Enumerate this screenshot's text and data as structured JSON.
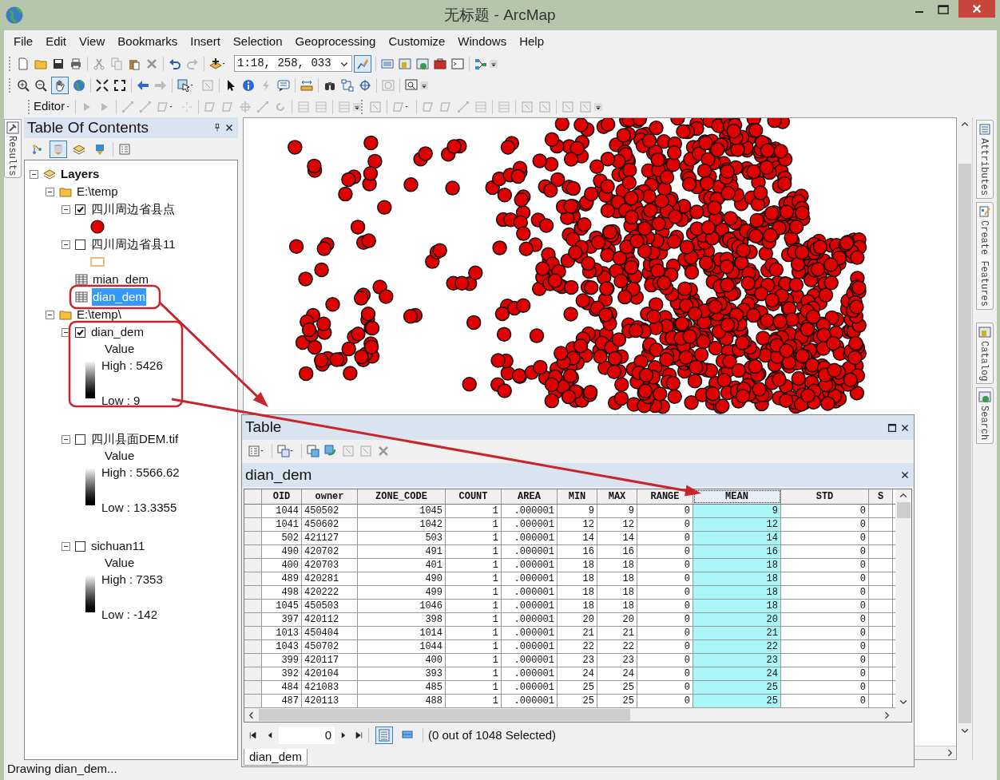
{
  "window": {
    "title": "无标题 - ArcMap"
  },
  "menu": [
    "File",
    "Edit",
    "View",
    "Bookmarks",
    "Insert",
    "Selection",
    "Geoprocessing",
    "Customize",
    "Windows",
    "Help"
  ],
  "standard_toolbar": {
    "scale": "1:18, 258, 033",
    "editor_toolbar_shown": true
  },
  "tools_toolbar": {
    "pan_tool": {
      "selected": true
    }
  },
  "editor_toolbar": {
    "label": "Editor"
  },
  "left_dock_tabs": [
    "Results"
  ],
  "toc": {
    "title": "Table Of Contents",
    "view_buttons": [
      {
        "kind": "drawing_order",
        "selected": false
      },
      {
        "kind": "source",
        "selected": true
      },
      {
        "kind": "visibility",
        "selected": false
      },
      {
        "kind": "selection",
        "selected": false
      }
    ],
    "tree": [
      {
        "label": "Layers",
        "kind": "frame",
        "expanded": true,
        "selected": false,
        "children": [
          {
            "label": "E:\\temp",
            "kind": "folder",
            "expanded": true,
            "selected": false,
            "children": [
              {
                "label": "四川周边省县点",
                "kind": "layer",
                "expanded": true,
                "checked": true,
                "selected": false,
                "legend": {
                  "kind": "point"
                }
              },
              {
                "label": "四川周边省县11",
                "kind": "layer",
                "expanded": true,
                "checked": false,
                "selected": false,
                "legend": {
                  "kind": "polygon"
                }
              },
              {
                "label": "mian_dem",
                "kind": "table",
                "selected": false
              },
              {
                "label": "dian_dem",
                "kind": "table",
                "selected": true
              }
            ]
          },
          {
            "label": "E:\\temp\\",
            "kind": "folder",
            "expanded": true,
            "selected": false,
            "children": [
              {
                "label": "dian_dem",
                "kind": "layer",
                "expanded": true,
                "checked": true,
                "selected": false,
                "legend": {
                  "kind": "raster",
                  "title": "Value",
                  "high": "High : 5426",
                  "low": "Low : 9"
                }
              },
              {
                "label": "四川县面DEM.tif",
                "kind": "layer",
                "expanded": true,
                "checked": false,
                "selected": false,
                "legend": {
                  "kind": "raster",
                  "title": "Value",
                  "high": "High : 5566.62",
                  "low": "Low : 13.3355"
                }
              },
              {
                "label": "sichuan11",
                "kind": "layer",
                "expanded": true,
                "checked": false,
                "selected": false,
                "legend": {
                  "kind": "raster",
                  "title": "Value",
                  "high": "High : 7353",
                  "low": "Low : -142"
                }
              }
            ]
          }
        ]
      }
    ]
  },
  "right_dock_groups": [
    {
      "tabs": [
        {
          "label": "Attributes",
          "kind": "attributes"
        },
        {
          "label": "Create Features",
          "kind": "create"
        }
      ]
    },
    {
      "tabs": [
        {
          "label": "Catalog",
          "kind": "catalog"
        },
        {
          "label": "Search",
          "kind": "search"
        }
      ]
    }
  ],
  "table_window": {
    "title": "Table",
    "table_name": "dian_dem",
    "columns": [
      {
        "label": "OID",
        "selected": false
      },
      {
        "label": "owner",
        "selected": false
      },
      {
        "label": "ZONE_CODE",
        "selected": false
      },
      {
        "label": "COUNT",
        "selected": false
      },
      {
        "label": "AREA",
        "selected": false
      },
      {
        "label": "MIN",
        "selected": false
      },
      {
        "label": "MAX",
        "selected": false
      },
      {
        "label": "RANGE",
        "selected": false
      },
      {
        "label": "MEAN",
        "selected": true
      },
      {
        "label": "STD",
        "selected": false
      },
      {
        "label": "S",
        "selected": false
      }
    ],
    "rows": [
      [
        "1044",
        "450502",
        "1045",
        "1",
        ".000001",
        "9",
        "9",
        "0",
        "9",
        "0"
      ],
      [
        "1041",
        "450602",
        "1042",
        "1",
        ".000001",
        "12",
        "12",
        "0",
        "12",
        "0"
      ],
      [
        "502",
        "421127",
        "503",
        "1",
        ".000001",
        "14",
        "14",
        "0",
        "14",
        "0"
      ],
      [
        "490",
        "420702",
        "491",
        "1",
        ".000001",
        "16",
        "16",
        "0",
        "16",
        "0"
      ],
      [
        "400",
        "420703",
        "401",
        "1",
        ".000001",
        "18",
        "18",
        "0",
        "18",
        "0"
      ],
      [
        "489",
        "420281",
        "490",
        "1",
        ".000001",
        "18",
        "18",
        "0",
        "18",
        "0"
      ],
      [
        "498",
        "420222",
        "499",
        "1",
        ".000001",
        "18",
        "18",
        "0",
        "18",
        "0"
      ],
      [
        "1045",
        "450503",
        "1046",
        "1",
        ".000001",
        "18",
        "18",
        "0",
        "18",
        "0"
      ],
      [
        "397",
        "420112",
        "398",
        "1",
        ".000001",
        "20",
        "20",
        "0",
        "20",
        "0"
      ],
      [
        "1013",
        "450404",
        "1014",
        "1",
        ".000001",
        "21",
        "21",
        "0",
        "21",
        "0"
      ],
      [
        "1043",
        "450702",
        "1044",
        "1",
        ".000001",
        "22",
        "22",
        "0",
        "22",
        "0"
      ],
      [
        "399",
        "420117",
        "400",
        "1",
        ".000001",
        "23",
        "23",
        "0",
        "23",
        "0"
      ],
      [
        "392",
        "420104",
        "393",
        "1",
        ".000001",
        "24",
        "24",
        "0",
        "24",
        "0"
      ],
      [
        "484",
        "421083",
        "485",
        "1",
        ".000001",
        "25",
        "25",
        "0",
        "25",
        "0"
      ],
      [
        "487",
        "420113",
        "488",
        "1",
        ".000001",
        "25",
        "25",
        "0",
        "25",
        "0"
      ]
    ],
    "record": "0",
    "selection_status": "(0 out of 1048 Selected)",
    "view_buttons": [
      {
        "kind": "all",
        "selected": true
      },
      {
        "kind": "selected",
        "selected": false
      }
    ],
    "bottom_tabs": [
      {
        "label": "dian_dem",
        "selected": true
      }
    ]
  },
  "status_bar": "Drawing dian_dem..."
}
